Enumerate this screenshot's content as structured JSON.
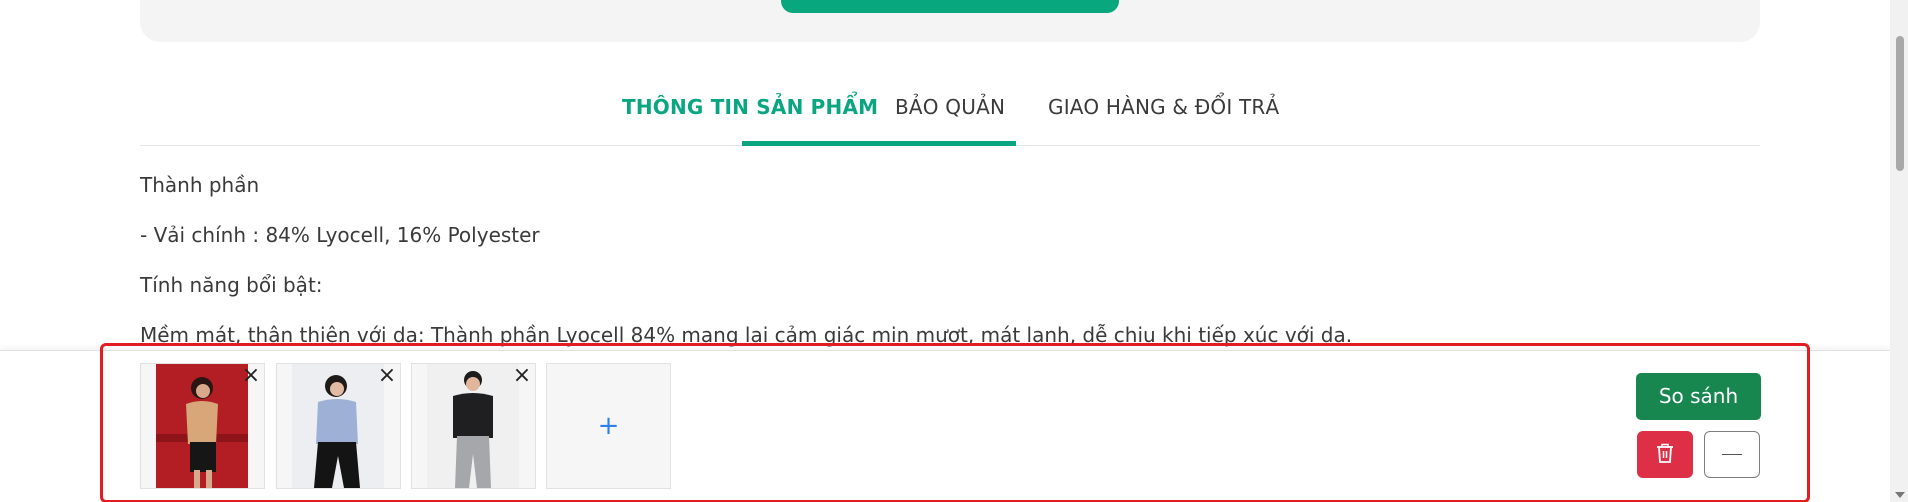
{
  "tabs": [
    {
      "label": "THÔNG TIN SẢN PHẨM",
      "active": true
    },
    {
      "label": "BẢO QUẢN",
      "active": false
    },
    {
      "label": "GIAO HÀNG & ĐỔI TRẢ",
      "active": false
    }
  ],
  "content": {
    "lines": [
      "Thành phần",
      "- Vải chính : 84% Lyocell, 16% Polyester",
      "Tính năng bổi bật:",
      "Mềm mát, thân thiện với da: Thành phần Lyocell 84% mang lại cảm giác mịn mượt, mát lạnh, dễ chịu khi tiếp xúc với da."
    ]
  },
  "compare": {
    "slots": [
      {
        "remove_label": "×"
      },
      {
        "remove_label": "×"
      },
      {
        "remove_label": "×"
      }
    ],
    "add_label": "+",
    "compare_button": "So sánh",
    "delete_icon": "trash-icon",
    "collapse_icon": "minus-icon"
  },
  "colors": {
    "accent": "#0aa682",
    "compare_button": "#17864f",
    "delete_button": "#dd2f45",
    "highlight_frame": "#e31b23"
  }
}
